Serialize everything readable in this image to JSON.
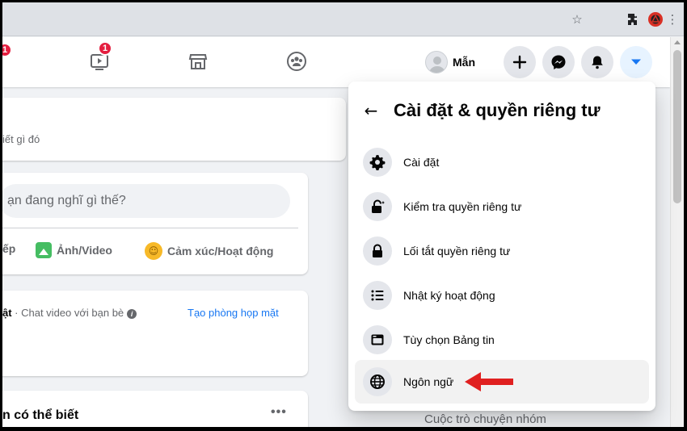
{
  "facebook": {
    "nav": {
      "left_badge": "1",
      "watch_badge": "1",
      "profile_name": "Mẫn"
    },
    "feed": {
      "status_hint": "iết gì đó",
      "composer_placeholder": "ạn đang nghĩ gì thế?",
      "actions": {
        "live_partial": "ếp",
        "photo_video": "Ảnh/Video",
        "feeling": "Cảm xúc/Hoạt động"
      },
      "room": {
        "title_bold": "ật",
        "title_rest": " · Chat video với bạn bè",
        "create_link": "Tạo phòng họp mặt"
      },
      "suggestions_title": "n có thể biết",
      "more": "•••",
      "group_chat_label": "Cuộc trò chuyện nhóm"
    },
    "dropdown": {
      "title": "Cài đặt & quyền riêng tư",
      "items": [
        {
          "label": "Cài đặt",
          "icon": "gear-icon"
        },
        {
          "label": "Kiểm tra quyền riêng tư",
          "icon": "lock-sparkle-icon"
        },
        {
          "label": "Lối tắt quyền riêng tư",
          "icon": "lock-icon"
        },
        {
          "label": "Nhật ký hoạt động",
          "icon": "list-icon"
        },
        {
          "label": "Tùy chọn Bảng tin",
          "icon": "feed-icon"
        },
        {
          "label": "Ngôn ngữ",
          "icon": "globe-icon"
        }
      ]
    }
  },
  "colors": {
    "accent": "#1877f2",
    "badge": "#e41e3f",
    "annotation_arrow": "#e02020"
  }
}
